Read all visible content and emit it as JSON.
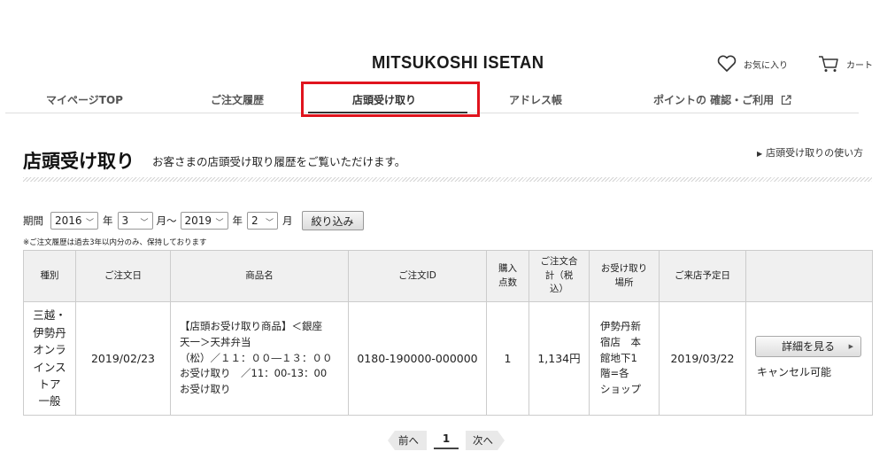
{
  "header": {
    "logo": "MITSUKOSHI ISETAN",
    "favorites_label": "お気に入り",
    "cart_label": "カート"
  },
  "nav": {
    "items": [
      {
        "label": "マイページTOP"
      },
      {
        "label": "ご注文履歴"
      },
      {
        "label": "店頭受け取り"
      },
      {
        "label": "アドレス帳"
      },
      {
        "label": "ポイントの 確認・ご利用"
      }
    ],
    "active_index": 2,
    "highlight_color": "#e0141e"
  },
  "page": {
    "title": "店頭受け取り",
    "subtitle": "お客さまの店頭受け取り履歴をご覧いただけます。",
    "howto_link": "店頭受け取りの使い方"
  },
  "filter": {
    "period_label": "期間",
    "from_year": "2016",
    "year_unit": "年",
    "from_month": "3",
    "month_tilde": "月〜",
    "to_year": "2019",
    "to_month": "2",
    "month_unit": "月",
    "button": "絞り込み",
    "note": "※ご注文履歴は過去3年以内分のみ、保持しております"
  },
  "table": {
    "headers": [
      "種別",
      "ご注文日",
      "商品名",
      "ご注文ID",
      "購入\n点数",
      "ご注文合\n計（税\n込）",
      "お受け取り\n場所",
      "ご来店予定日",
      ""
    ],
    "rows": [
      {
        "kind": "三越・\n伊勢丹\nオンラ\nインス\nトア\n一般",
        "order_date": "2019/02/23",
        "product": "【店頭お受け取り商品】＜銀座\n天一＞天丼弁当\n（松）／１１：００―１３：００\nお受け取り　／11：00-13：00\nお受け取り",
        "order_id": "0180-190000-000000",
        "qty": "1",
        "total": "1,134円",
        "place": "伊勢丹新\n宿店　本\n館地下1\n階=各\nショップ",
        "visit_date": "2019/03/22",
        "detail_button": "詳細を見る",
        "status": "キャンセル可能"
      }
    ]
  },
  "pager": {
    "prev": "前へ",
    "current": "1",
    "next": "次へ"
  }
}
